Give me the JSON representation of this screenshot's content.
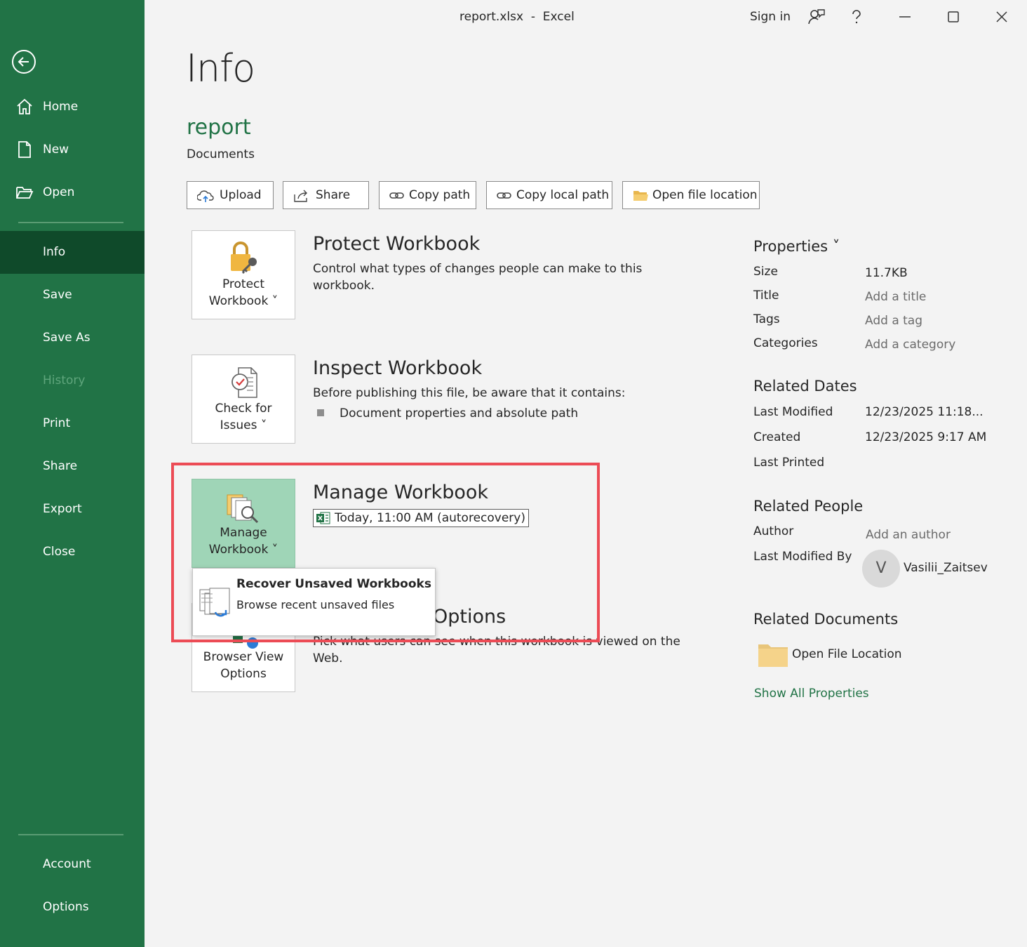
{
  "titlebar": {
    "title": "report.xlsx  -  Excel",
    "sign_in": "Sign in"
  },
  "sidebar": {
    "items": [
      {
        "label": "Home"
      },
      {
        "label": "New"
      },
      {
        "label": "Open"
      },
      {
        "label": "Info"
      },
      {
        "label": "Save"
      },
      {
        "label": "Save As"
      },
      {
        "label": "History"
      },
      {
        "label": "Print"
      },
      {
        "label": "Share"
      },
      {
        "label": "Export"
      },
      {
        "label": "Close"
      },
      {
        "label": "Account"
      },
      {
        "label": "Options"
      }
    ]
  },
  "page": {
    "title": "Info",
    "doc_name": "report",
    "doc_location": "Documents"
  },
  "actions": {
    "upload": "Upload",
    "share": "Share",
    "copy_path": "Copy path",
    "copy_local_path": "Copy local path",
    "open_file_location": "Open file location"
  },
  "protect": {
    "tile_line1": "Protect",
    "tile_line2": "Workbook ˅",
    "title": "Protect Workbook",
    "desc_line1": "Control what types of changes people can make to this",
    "desc_line2": "workbook."
  },
  "inspect": {
    "tile_line1": "Check for",
    "tile_line2": "Issues ˅",
    "title": "Inspect Workbook",
    "desc": "Before publishing this file, be aware that it contains:",
    "bullet": "Document properties and absolute path"
  },
  "manage": {
    "tile_line1": "Manage",
    "tile_line2": "Workbook ˅",
    "title": "Manage Workbook",
    "autorecovery": "Today, 11:00 AM (autorecovery)"
  },
  "dropdown": {
    "title": "Recover Unsaved Workbooks",
    "desc": "Browse recent unsaved files"
  },
  "browser_view": {
    "tile_line1": "Browser View",
    "tile_line2": "Options",
    "title_fragment": "Options",
    "desc_line1": "Pick what users can see when this workbook is viewed on the",
    "desc_line2": "Web."
  },
  "properties": {
    "heading": "Properties ˅",
    "size_label": "Size",
    "size_value": "11.7KB",
    "title_label": "Title",
    "title_value": "Add a title",
    "tags_label": "Tags",
    "tags_value": "Add a tag",
    "categories_label": "Categories",
    "categories_value": "Add a category"
  },
  "related_dates": {
    "heading": "Related Dates",
    "last_modified_label": "Last Modified",
    "last_modified_value": "12/23/2025 11:18...",
    "created_label": "Created",
    "created_value": "12/23/2025 9:17 AM",
    "last_printed_label": "Last Printed"
  },
  "related_people": {
    "heading": "Related People",
    "author_label": "Author",
    "author_value": "Add an author",
    "last_modified_by_label": "Last Modified By",
    "avatar_initial": "V",
    "last_modified_by_value": "Vasilii_Zaitsev"
  },
  "related_documents": {
    "heading": "Related Documents",
    "open_file_location": "Open File Location",
    "show_all": "Show All Properties"
  },
  "colors": {
    "brand": "#217346",
    "selected_tile": "#9fd5b7",
    "highlight": "#ec4b55"
  }
}
